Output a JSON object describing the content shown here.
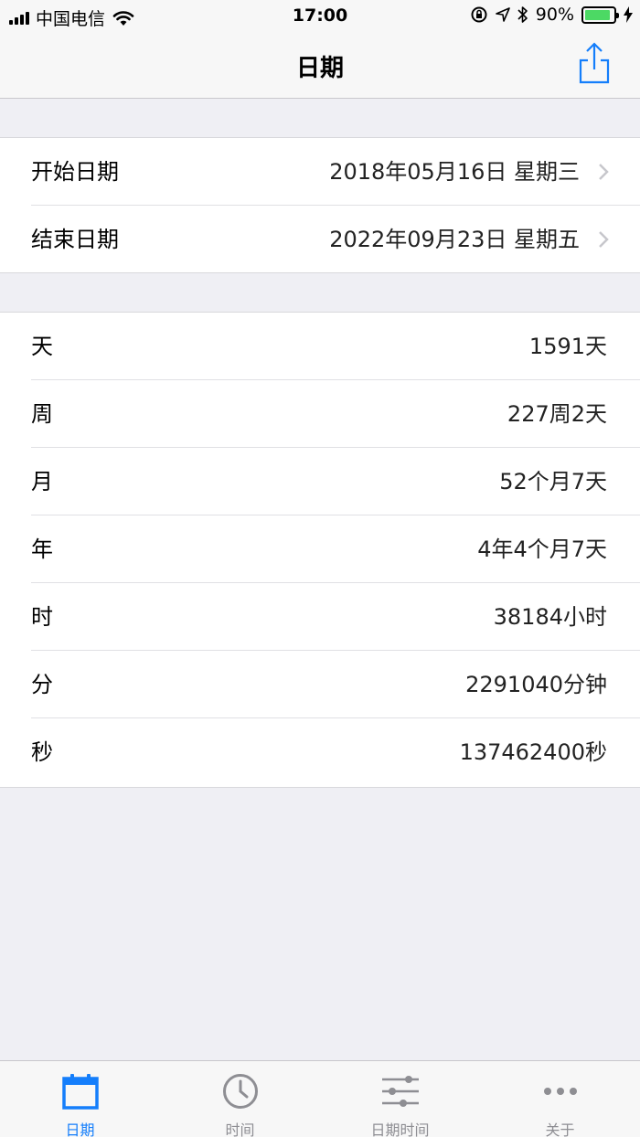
{
  "status_bar": {
    "carrier": "中国电信",
    "time": "17:00",
    "battery": "90%"
  },
  "nav": {
    "title": "日期"
  },
  "dates": [
    {
      "label": "开始日期",
      "value": "2018年05月16日 星期三"
    },
    {
      "label": "结束日期",
      "value": "2022年09月23日 星期五"
    }
  ],
  "results": [
    {
      "label": "天",
      "value": "1591天"
    },
    {
      "label": "周",
      "value": "227周2天"
    },
    {
      "label": "月",
      "value": "52个月7天"
    },
    {
      "label": "年",
      "value": "4年4个月7天"
    },
    {
      "label": "时",
      "value": "38184小时"
    },
    {
      "label": "分",
      "value": "2291040分钟"
    },
    {
      "label": "秒",
      "value": "137462400秒"
    }
  ],
  "tabs": [
    {
      "label": "日期",
      "icon": "calendar-icon",
      "active": true
    },
    {
      "label": "时间",
      "icon": "clock-icon",
      "active": false
    },
    {
      "label": "日期时间",
      "icon": "sliders-icon",
      "active": false
    },
    {
      "label": "关于",
      "icon": "more-icon",
      "active": false
    }
  ],
  "colors": {
    "accent": "#147efb",
    "battery": "#4cd964",
    "background": "#efeff4"
  }
}
